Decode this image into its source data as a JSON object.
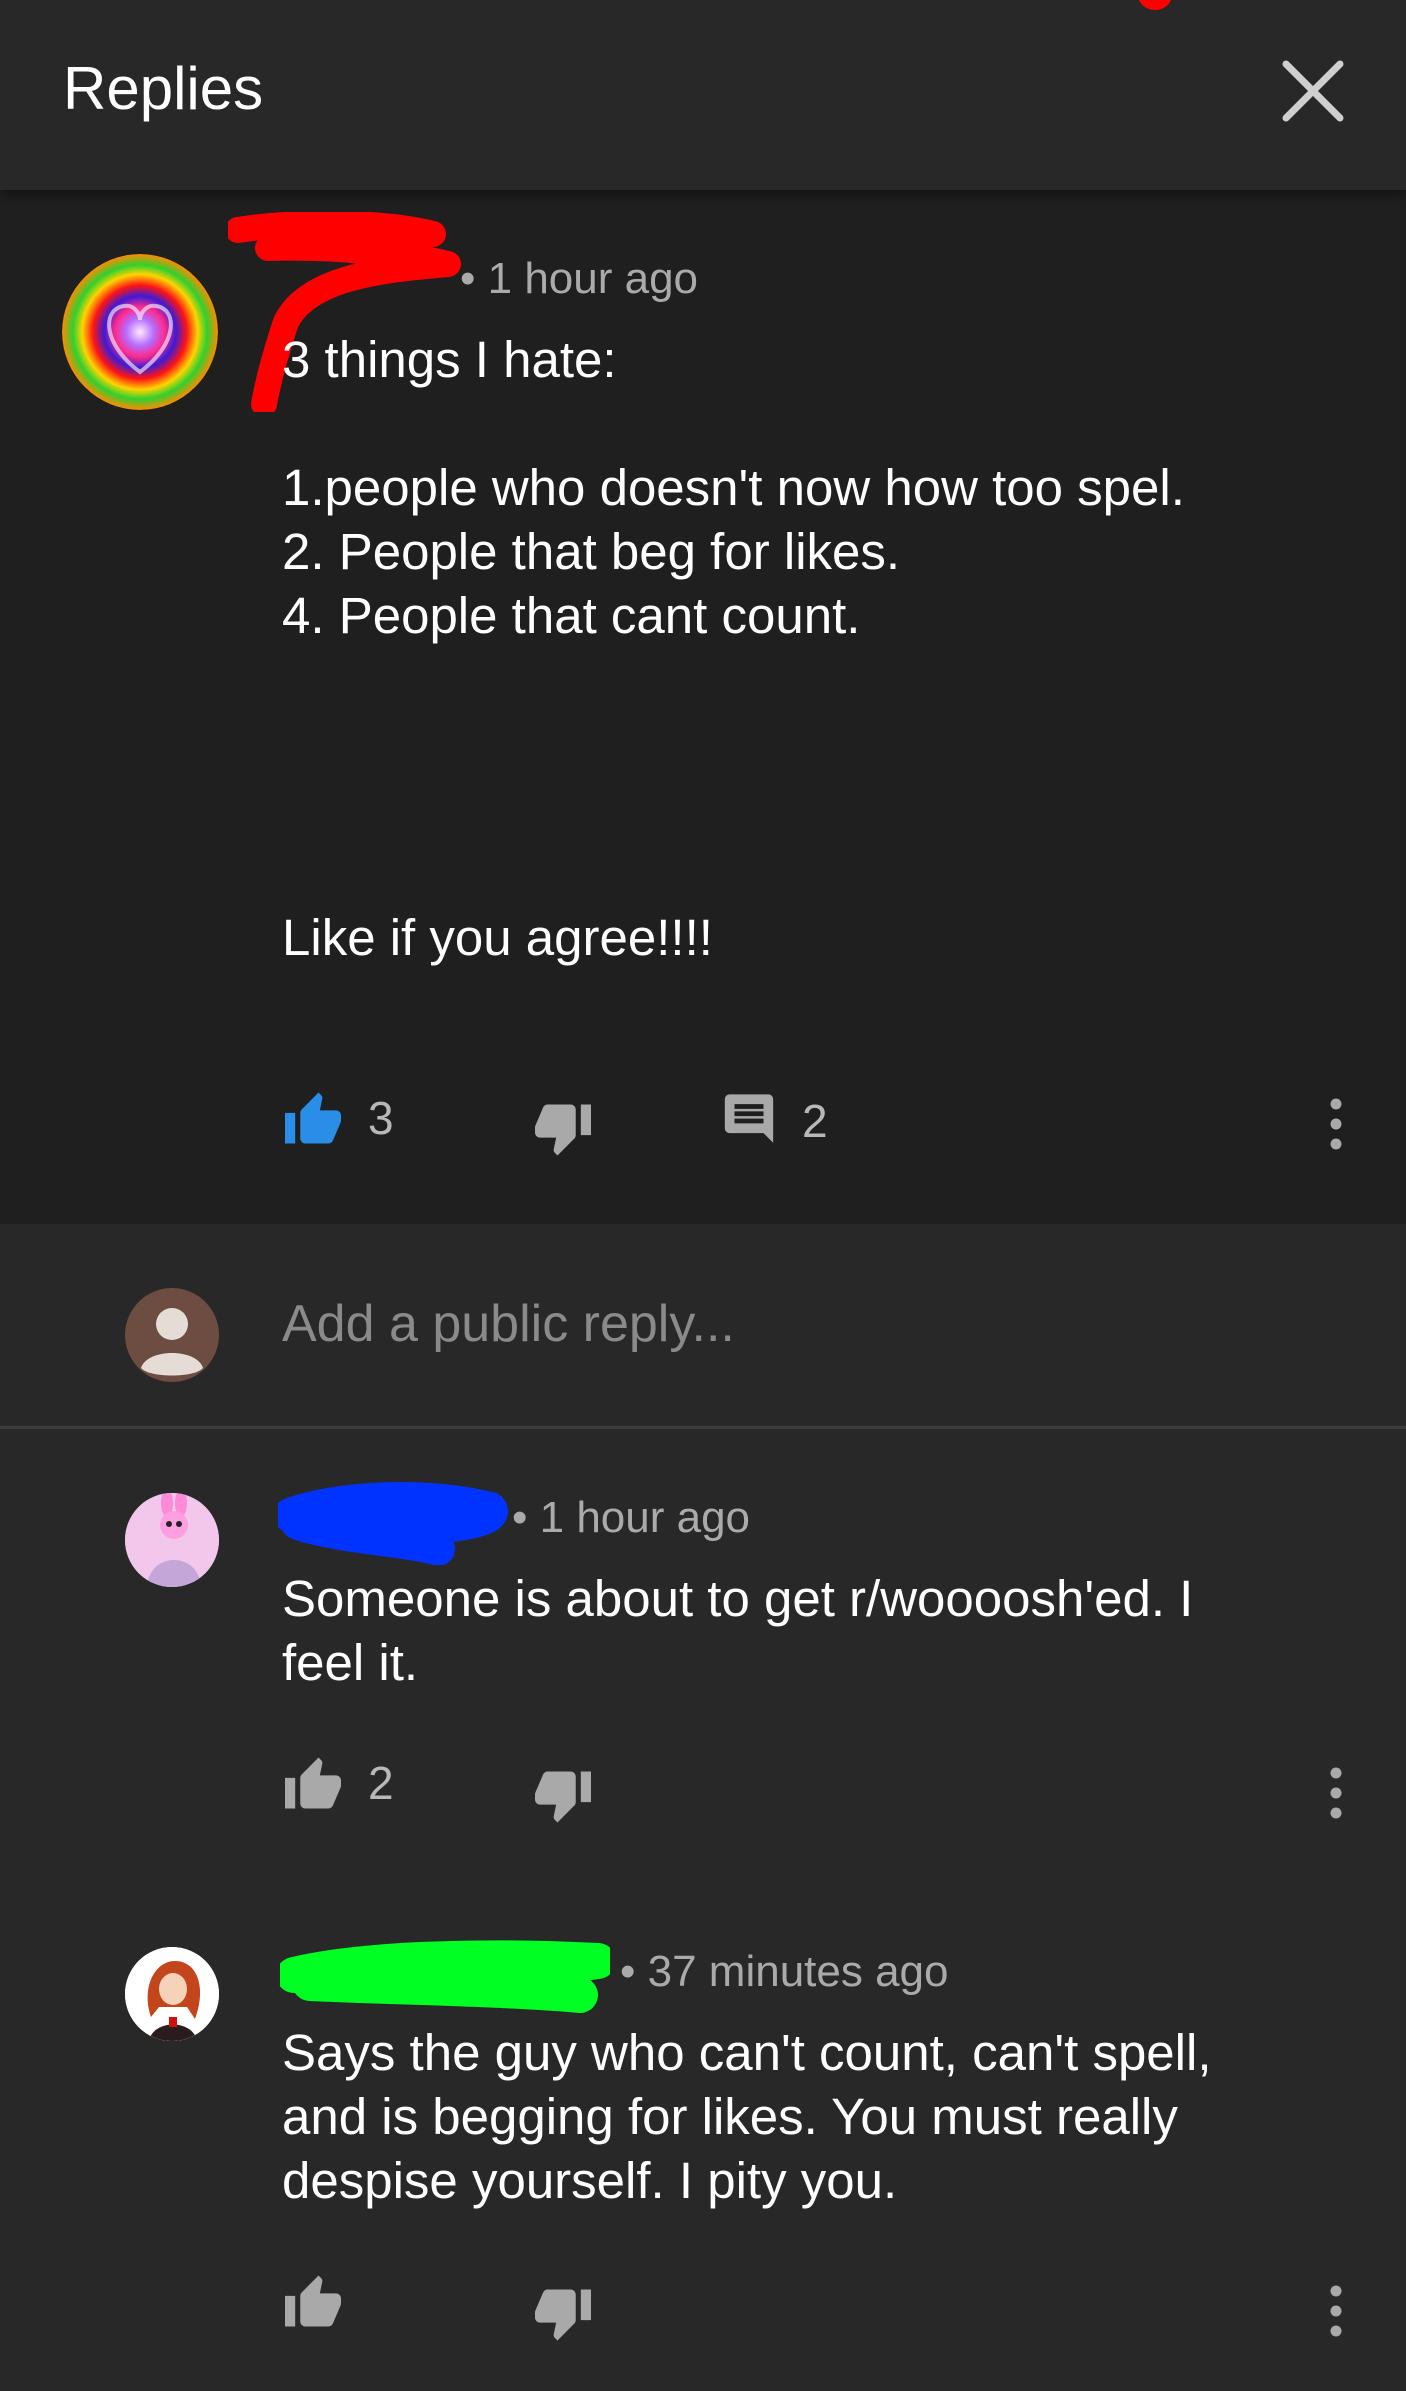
{
  "header": {
    "title": "Replies"
  },
  "top_comment": {
    "author_redacted": true,
    "time": "• 1 hour ago",
    "lines": [
      "3 things I hate:",
      "",
      "1.people who doesn't now how too spel.",
      "2. People that beg for likes.",
      "4. People that cant count.",
      "",
      "Like if you agree!!!!"
    ],
    "likes": "3",
    "reply_count": "2",
    "liked": true
  },
  "reply_input": {
    "placeholder": "Add a public reply..."
  },
  "replies": [
    {
      "time": "• 1 hour ago",
      "lines": [
        "Someone is about to get r/woooosh'ed. I",
        "feel it."
      ],
      "likes": "2"
    },
    {
      "time": "• 37 minutes ago",
      "lines": [
        "Says the guy who can't count, can't spell,",
        "and is begging for likes. You must really",
        "despise yourself. I pity you."
      ],
      "likes": ""
    }
  ],
  "colors": {
    "like_active": "#2a8ee8",
    "icon_inactive": "#a9a9a9",
    "scribble_red": "#ff0000",
    "scribble_blue": "#0033ff",
    "scribble_green": "#00ff22"
  },
  "icons": {
    "close": "close-icon",
    "like": "thumbs-up-icon",
    "dislike": "thumbs-down-icon",
    "reply": "comment-icon",
    "more": "more-vert-icon",
    "user": "user-avatar-icon"
  }
}
